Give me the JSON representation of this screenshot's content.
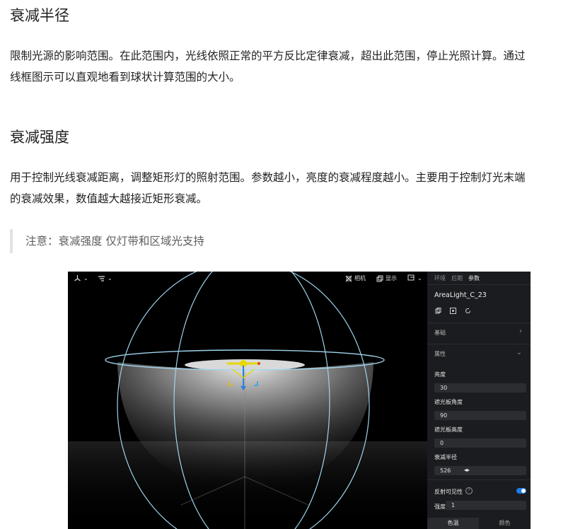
{
  "section1": {
    "heading": "衰减半径",
    "paragraph_line1": "限制光源的影响范围。在此范围内，光线依照正常的平方反比定律衰减，超出此范围，停止光照计算。通过",
    "paragraph_line2": "线框图示可以直观地看到球状计算范围的大小。"
  },
  "section2": {
    "heading": "衰减强度",
    "paragraph_line1": "用于控制光线衰减距离，调整矩形灯的照射范围。参数越小，亮度的衰减程度越小。主要用于控制灯光末端",
    "paragraph_line2": "的衰减效果，数值越大越接近矩形衰减。"
  },
  "note": {
    "text": "注意：衰减强度 仅灯带和区域光支持"
  },
  "screenshot": {
    "toolbar": {
      "camera_label": "相机",
      "display_label": "显示"
    },
    "panel": {
      "tabs": [
        "环境",
        "后期",
        "参数"
      ],
      "object_name": "AreaLight_C_23",
      "section_basic": "基础",
      "section_props": "属性",
      "fields": {
        "brightness": {
          "label": "亮度",
          "value": "30"
        },
        "shade_angle": {
          "label": "遮光板角度",
          "value": "90"
        },
        "shade_height": {
          "label": "遮光板高度",
          "value": "0"
        },
        "falloff_radius": {
          "label": "衰减半径",
          "value": "526"
        }
      },
      "reflect_visible_label": "反射可见性",
      "reflect_visible_on": true,
      "intensity": {
        "label": "强度",
        "value": "1"
      },
      "bottom_tabs": [
        "色温",
        "颜色"
      ]
    },
    "colors": {
      "wire": "#9fd4ee",
      "toggle": "#1f7be6",
      "gizmo_yellow": "#e6d800",
      "gizmo_blue": "#2a7fe0"
    }
  }
}
